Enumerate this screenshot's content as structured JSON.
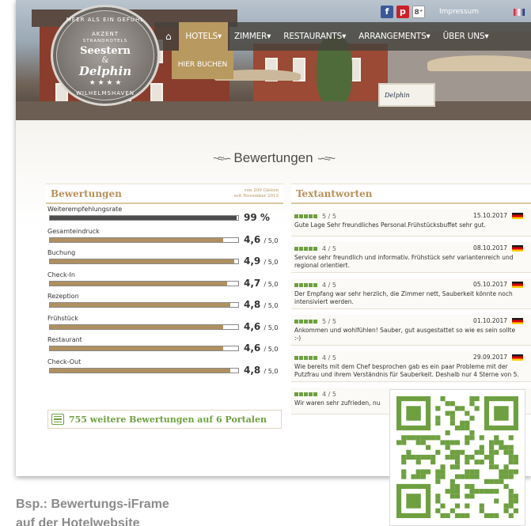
{
  "topbar": {
    "social": [
      {
        "icon": "facebook-icon",
        "glyph": "f"
      },
      {
        "icon": "pinterest-icon",
        "glyph": "p"
      },
      {
        "icon": "googleplus-icon",
        "glyph": "8⁺"
      }
    ],
    "impressum": "Impressum"
  },
  "logo": {
    "arc_top": "MEER ALS EIN GEFÜHL",
    "line1": "AKZENT",
    "line2": "STRANDHOTELS",
    "line3": "Seestern",
    "line4": "&",
    "line5": "Delphin",
    "stars": "★ ★ ★ ★",
    "arc_bottom": "WILHELMSHAVEN"
  },
  "nav": {
    "home_icon": "home-icon",
    "items": [
      "HOTELS▾",
      "ZIMMER▾",
      "RESTAURANTS▾",
      "ARRANGEMENTS▾",
      "ÜBER UNS▾"
    ],
    "book": "HIER BUCHEN"
  },
  "hero": {
    "sign_text": "Delphin"
  },
  "page": {
    "heading": "Bewertungen"
  },
  "ratings": {
    "title": "Bewertungen",
    "subtitle_line1": "von 209 Gästen",
    "subtitle_line2": "seit November 2015",
    "rows": [
      {
        "label": "Weiterempfehlungsrate",
        "value": "99 %",
        "fraction": 0.99,
        "dark": true
      },
      {
        "label": "Gesamteindruck",
        "value": "4,6",
        "of": "/ 5,0",
        "fraction": 0.92
      },
      {
        "label": "Buchung",
        "value": "4,9",
        "of": "/ 5,0",
        "fraction": 0.98
      },
      {
        "label": "Check-In",
        "value": "4,7",
        "of": "/ 5,0",
        "fraction": 0.94
      },
      {
        "label": "Rezeption",
        "value": "4,8",
        "of": "/ 5,0",
        "fraction": 0.96
      },
      {
        "label": "Frühstück",
        "value": "4,6",
        "of": "/ 5,0",
        "fraction": 0.92
      },
      {
        "label": "Restaurant",
        "value": "4,6",
        "of": "/ 5,0",
        "fraction": 0.92
      },
      {
        "label": "Check-Out",
        "value": "4,8",
        "of": "/ 5,0",
        "fraction": 0.96
      }
    ],
    "more_link": "755 weitere Bewertungen auf 6 Portalen"
  },
  "reviews": {
    "title": "Textantworten",
    "items": [
      {
        "score": "5 / 5",
        "date": "15.10.2017",
        "text": "Gute Lage Sehr freundliches Personal.Frühstücksbuffet sehr gut."
      },
      {
        "score": "4 / 5",
        "date": "08.10.2017",
        "text": "Service sehr freundlich und informativ. Frühstück sehr variantenreich und regional orientiert."
      },
      {
        "score": "4 / 5",
        "date": "05.10.2017",
        "text": "Der Empfang war sehr herzlich, die Zimmer nett, Sauberkeit könnte noch intensiviert werden."
      },
      {
        "score": "5 / 5",
        "date": "01.10.2017",
        "text": "Ankommen und wohlfühlen! Sauber, gut ausgestattet so wie es sein sollte :-)"
      },
      {
        "score": "4 / 5",
        "date": "29.09.2017",
        "text": "Wie bereits mit dem Chef besprochen gab es ein paar Probleme mit der Putzfrau und ihrem Verständnis für Sauberkeit. Deshalb nur 4 Sterne von 5."
      },
      {
        "score": "4 / 5",
        "date": "",
        "text": "Wir waren sehr zufrieden, nu"
      }
    ]
  },
  "caption": {
    "line1": "Bsp.: Bewertungs-iFrame",
    "line2": "auf der Hotelwebsite"
  },
  "colors": {
    "gold": "#b8995f",
    "green": "#6ea040",
    "nav": "#46423c"
  }
}
